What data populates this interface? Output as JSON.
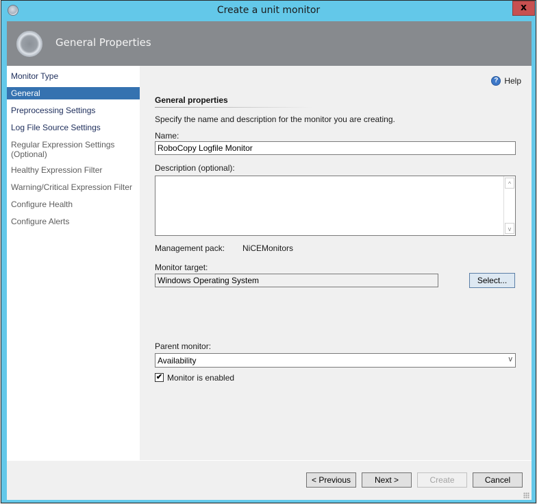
{
  "window": {
    "title": "Create a unit monitor",
    "close_label": "x"
  },
  "header": {
    "title": "General Properties"
  },
  "nav": {
    "items": [
      {
        "label": "Monitor Type",
        "state": "link"
      },
      {
        "label": "General",
        "state": "selected"
      },
      {
        "label": "Preprocessing Settings",
        "state": "link"
      },
      {
        "label": "Log File Source Settings",
        "state": "link"
      },
      {
        "label": "Regular Expression Settings",
        "label2": "(Optional)",
        "state": "muted"
      },
      {
        "label": "Healthy Expression Filter",
        "state": "muted"
      },
      {
        "label": "Warning/Critical Expression Filter",
        "state": "muted"
      },
      {
        "label": "Configure Health",
        "state": "muted"
      },
      {
        "label": "Configure Alerts",
        "state": "muted"
      }
    ]
  },
  "content": {
    "help_label": "Help",
    "help_icon": "?",
    "section_title": "General properties",
    "instruction": "Specify the name and description for the monitor you are creating.",
    "name_label": "Name:",
    "name_value": "RoboCopy Logfile Monitor",
    "description_label": "Description (optional):",
    "description_value": "",
    "management_pack_label": "Management pack:",
    "management_pack_value": "NiCEMonitors",
    "monitor_target_label": "Monitor target:",
    "monitor_target_value": "Windows Operating System",
    "select_button": "Select...",
    "parent_monitor_label": "Parent monitor:",
    "parent_monitor_value": "Availability",
    "enabled_label": "Monitor is enabled",
    "enabled_checked": true
  },
  "footer": {
    "previous": "< Previous",
    "next": "Next >",
    "create": "Create",
    "cancel": "Cancel"
  },
  "icons": {
    "scroll_up": "^",
    "scroll_down": "v",
    "dropdown": "v",
    "check": "✔"
  }
}
